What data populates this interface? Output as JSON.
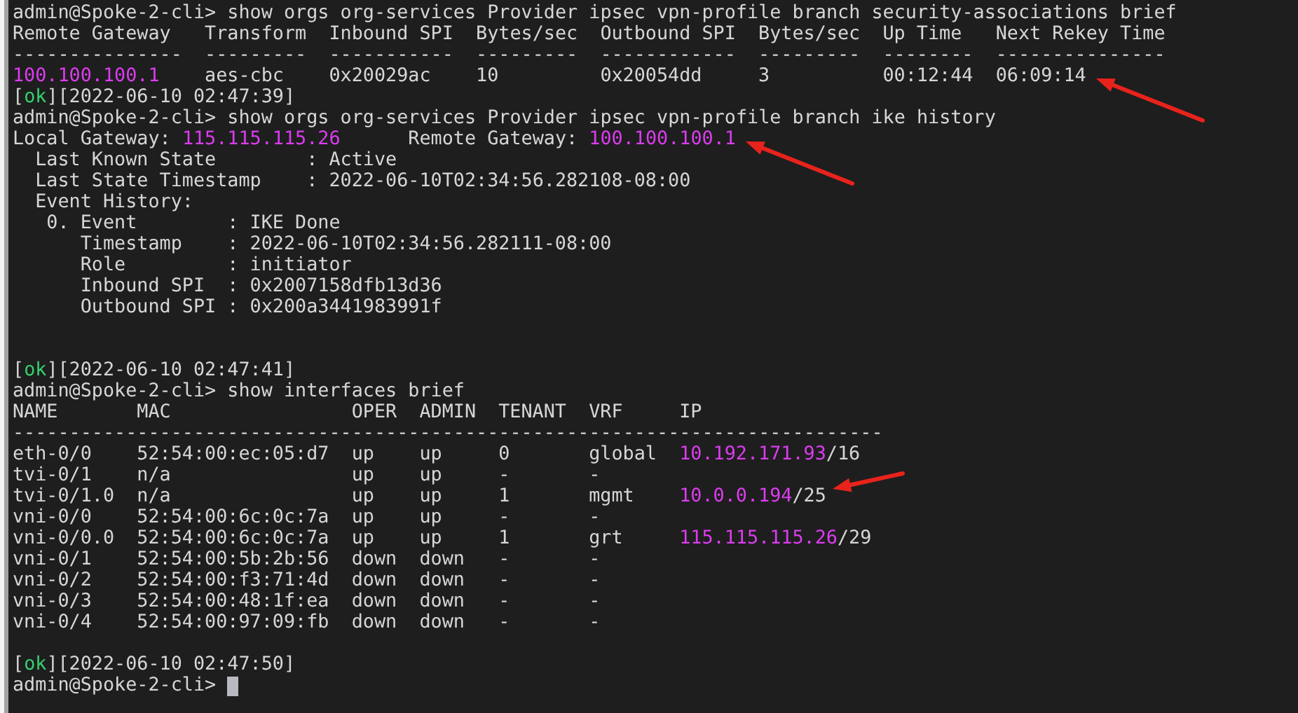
{
  "terminal": {
    "blocks": [
      {
        "kind": "command",
        "text": "admin@Spoke-2-cli> show orgs org-services Provider ipsec vpn-profile branch security-associations brief"
      },
      {
        "kind": "table",
        "columns": [
          "Remote Gateway",
          "Transform",
          "Inbound SPI",
          "Bytes/sec",
          "Outbound SPI",
          "Bytes/sec",
          "Up Time",
          "Next Rekey Time"
        ],
        "rule": [
          "---------------",
          "---------",
          "-----------",
          "---------",
          "------------",
          "---------",
          "--------",
          "---------------"
        ],
        "rows": [
          [
            {
              "text": "100.100.100.1",
              "highlight": true
            },
            "aes-cbc",
            "0x20029ac",
            "10",
            "0x20054dd",
            "3",
            "00:12:44",
            {
              "text": "06:09:14",
              "highlight": false,
              "annotation": {
                "kind": "arrow-from-lower-right"
              }
            }
          ]
        ]
      },
      {
        "kind": "status",
        "before": "[",
        "tag": "ok",
        "after": "][2022-06-10 02:47:39]"
      },
      {
        "kind": "command",
        "text": "admin@Spoke-2-cli> show orgs org-services Provider ipsec vpn-profile branch ike history"
      },
      {
        "kind": "gateways",
        "local": {
          "label": "Local Gateway:",
          "ip": "115.115.115.26"
        },
        "remote": {
          "label": "Remote Gateway:",
          "ip": "100.100.100.1",
          "annotation": {
            "kind": "arrow-from-lower-right"
          }
        }
      },
      {
        "kind": "fields",
        "items": [
          {
            "label": "Last Known State",
            "value": ": Active"
          },
          {
            "label": "Last State Timestamp",
            "value": ": 2022-06-10T02:34:56.282108-08:00"
          },
          {
            "label": "Event History:",
            "children": [
              {
                "marker": "0.",
                "items": [
                  {
                    "label": "Event",
                    "value": ": IKE Done"
                  },
                  {
                    "label": "Timestamp",
                    "value": ": 2022-06-10T02:34:56.282111-08:00"
                  },
                  {
                    "label": "Role",
                    "value": ": initiator"
                  },
                  {
                    "label": "Inbound SPI",
                    "value": ": 0x2007158dfb13d36"
                  },
                  {
                    "label": "Outbound SPI",
                    "value": ": 0x200a3441983991f"
                  }
                ]
              }
            ]
          }
        ]
      },
      {
        "kind": "blank"
      },
      {
        "kind": "blank"
      },
      {
        "kind": "status",
        "before": "[",
        "tag": "ok",
        "after": "][2022-06-10 02:47:41]"
      },
      {
        "kind": "command",
        "text": "admin@Spoke-2-cli> show interfaces brief"
      },
      {
        "kind": "table",
        "columns": [
          "NAME",
          "MAC",
          "OPER",
          "ADMIN",
          "TENANT",
          "VRF",
          "IP"
        ],
        "rule": "-----------------------------------------------------------------------------",
        "rows": [
          [
            "eth-0/0",
            "52:54:00:ec:05:d7",
            "up",
            "up",
            "0",
            "global",
            {
              "text": "10.192.171.93",
              "highlight": true,
              "suffix": "/16"
            }
          ],
          [
            "tvi-0/1",
            "n/a",
            "up",
            "up",
            "-",
            "-"
          ],
          [
            "tvi-0/1.0",
            "n/a",
            "up",
            "up",
            "1",
            "mgmt",
            {
              "text": "10.0.0.194",
              "highlight": true,
              "suffix": "/25",
              "annotation": {
                "kind": "arrow-from-upper-right"
              }
            }
          ],
          [
            "vni-0/0",
            "52:54:00:6c:0c:7a",
            "up",
            "up",
            "-",
            "-"
          ],
          [
            "vni-0/0.0",
            "52:54:00:6c:0c:7a",
            "up",
            "up",
            "1",
            "grt",
            {
              "text": "115.115.115.26",
              "highlight": true,
              "suffix": "/29"
            }
          ],
          [
            "vni-0/1",
            "52:54:00:5b:2b:56",
            "down",
            "down",
            "-",
            "-"
          ],
          [
            "vni-0/2",
            "52:54:00:f3:71:4d",
            "down",
            "down",
            "-",
            "-"
          ],
          [
            "vni-0/3",
            "52:54:00:48:1f:ea",
            "down",
            "down",
            "-",
            "-"
          ],
          [
            "vni-0/4",
            "52:54:00:97:09:fb",
            "down",
            "down",
            "-",
            "-"
          ]
        ]
      },
      {
        "kind": "blank"
      },
      {
        "kind": "status",
        "before": "[",
        "tag": "ok",
        "after": "][2022-06-10 02:47:50]"
      },
      {
        "kind": "prompt",
        "text": "admin@Spoke-2-cli>",
        "cursor": true
      }
    ]
  }
}
